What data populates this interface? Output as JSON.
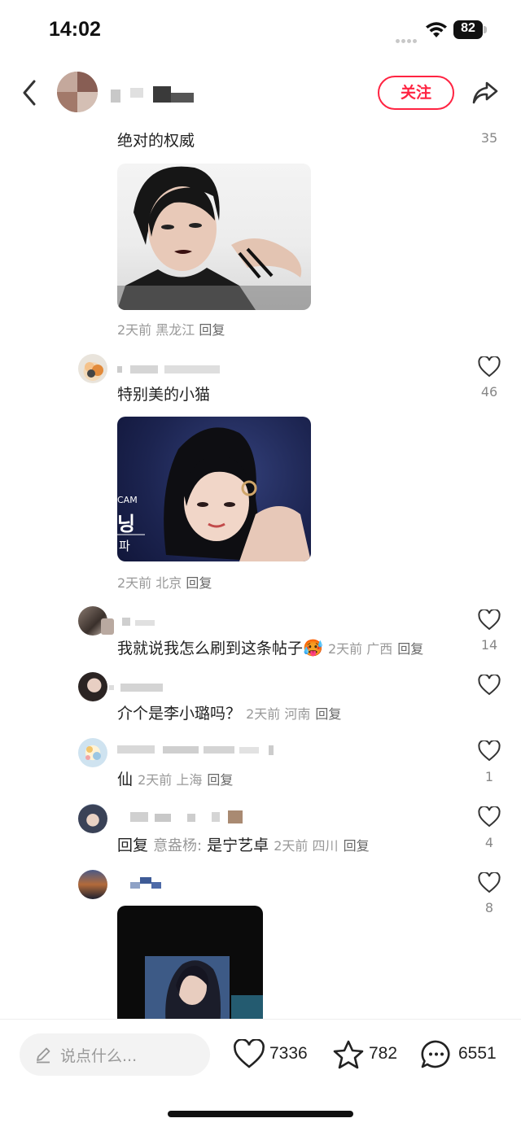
{
  "status_bar": {
    "time": "14:02",
    "battery": "82"
  },
  "header": {
    "follow_label": "关注"
  },
  "comments": [
    {
      "text": "绝对的权威",
      "likes": "35",
      "meta": "2天前 黑龙江",
      "reply": "回复"
    },
    {
      "text": "特别美的小猫",
      "likes": "46",
      "meta": "2天前 北京",
      "reply": "回复"
    },
    {
      "text": "我就说我怎么刷到这条帖子",
      "emoji": "🥵",
      "likes": "14",
      "meta": "2天前 广西",
      "reply": "回复"
    },
    {
      "text": "介个是李小璐吗？",
      "likes": "",
      "meta": "2天前 河南",
      "reply": "回复"
    },
    {
      "text": "仙",
      "likes": "1",
      "meta": "2天前 上海",
      "reply": "回复"
    },
    {
      "prefix": "回复",
      "mention": "意盎杨:",
      "text": " 是宁艺卓",
      "likes": "4",
      "meta": "2天前 四川",
      "reply": "回复"
    },
    {
      "likes": "8"
    }
  ],
  "image_overlay": {
    "cam": "CAM",
    "korean": "닝",
    "korean_sub": "파"
  },
  "bottom_bar": {
    "placeholder": "说点什么...",
    "likes": "7336",
    "favorites": "782",
    "comments": "6551"
  },
  "colors": {
    "accent": "#ff2442",
    "meta": "#999999"
  },
  "icons": [
    "back-icon",
    "share-icon",
    "heart-icon",
    "star-icon",
    "comment-icon",
    "pencil-icon",
    "wifi-icon",
    "battery-icon"
  ]
}
